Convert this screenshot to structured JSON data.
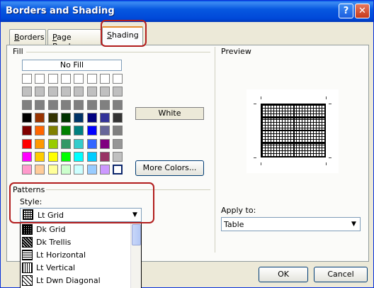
{
  "window": {
    "title": "Borders and Shading",
    "help_glyph": "?",
    "close_glyph": "✕"
  },
  "tabs": [
    {
      "label_u": "B",
      "label_rest": "orders"
    },
    {
      "label_u": "P",
      "label_rest": "age Border"
    },
    {
      "label_u": "S",
      "label_rest": "hading"
    }
  ],
  "fill": {
    "group_label": "Fill",
    "no_fill_label": "No Fill",
    "selected_color_name": "White",
    "more_colors_label": "More Colors...",
    "palette": [
      [
        "#ffffff",
        "#ffffff",
        "#ffffff",
        "#ffffff",
        "#ffffff",
        "#ffffff",
        "#ffffff",
        "#ffffff"
      ],
      [
        "#c0c0c0",
        "#c0c0c0",
        "#c0c0c0",
        "#c0c0c0",
        "#c0c0c0",
        "#c0c0c0",
        "#c0c0c0",
        "#c0c0c0"
      ],
      [
        "#808080",
        "#808080",
        "#808080",
        "#808080",
        "#808080",
        "#808080",
        "#808080",
        "#808080"
      ],
      [
        "#000000",
        "#993300",
        "#333300",
        "#003300",
        "#003366",
        "#000080",
        "#333399",
        "#333333"
      ],
      [
        "#800000",
        "#ff6600",
        "#808000",
        "#008000",
        "#008080",
        "#0000ff",
        "#666699",
        "#808080"
      ],
      [
        "#ff0000",
        "#ff9900",
        "#99cc00",
        "#339966",
        "#33cccc",
        "#3366ff",
        "#800080",
        "#969696"
      ],
      [
        "#ff00ff",
        "#ffcc00",
        "#ffff00",
        "#00ff00",
        "#00ffff",
        "#00ccff",
        "#993366",
        "#c0c0c0"
      ],
      [
        "#ff99cc",
        "#ffcc99",
        "#ffff99",
        "#ccffcc",
        "#ccffff",
        "#99ccff",
        "#cc99ff",
        "#ffffff"
      ]
    ]
  },
  "patterns": {
    "group_label": "Patterns",
    "style_label": "Style:",
    "style_value": "Lt Grid",
    "options": [
      {
        "label": "Dk Grid",
        "icon": "dk-grid-pattern-icon"
      },
      {
        "label": "Dk Trellis",
        "icon": "dk-trellis-pattern-icon"
      },
      {
        "label": "Lt Horizontal",
        "icon": "lt-horizontal-pattern-icon"
      },
      {
        "label": "Lt Vertical",
        "icon": "lt-vertical-pattern-icon"
      },
      {
        "label": "Lt Dwn Diagonal",
        "icon": "lt-dwn-diagonal-pattern-icon"
      }
    ]
  },
  "preview": {
    "group_label": "Preview"
  },
  "apply_to": {
    "label": "Apply to:",
    "value": "Table"
  },
  "buttons": {
    "ok": "OK",
    "cancel": "Cancel"
  },
  "colors": {
    "highlight_outline": "#b21d1d",
    "title_bar": "#0758e0"
  }
}
